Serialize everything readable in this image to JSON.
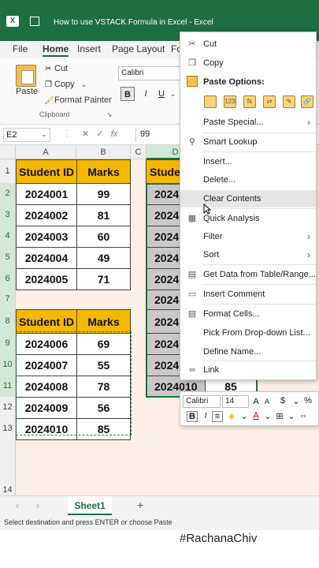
{
  "titlebar": {
    "app_icon": "excel-icon",
    "title": "How to use VSTACK Formula in Excel  -  Excel"
  },
  "ribbon_tabs": [
    "File",
    "Home",
    "Insert",
    "Page Layout",
    "Fo"
  ],
  "ribbon": {
    "paste_label": "Paste",
    "cut_label": "Cut",
    "copy_label": "Copy",
    "format_painter_label": "Format Painter",
    "clipboard_group_label": "Clipboard",
    "font_name": "Calibri",
    "bold": "B",
    "italic": "I",
    "underline": "U"
  },
  "formula_bar": {
    "name_box": "E2",
    "fx_label": "fx",
    "value": "99"
  },
  "columns": [
    "A",
    "B",
    "C",
    "D"
  ],
  "rows": [
    "1",
    "2",
    "3",
    "4",
    "5",
    "6",
    "7",
    "8",
    "9",
    "10",
    "11",
    "12",
    "13",
    "14"
  ],
  "table1": {
    "headers": [
      "Student ID",
      "Marks"
    ],
    "rows": [
      [
        "2024001",
        "99"
      ],
      [
        "2024002",
        "81"
      ],
      [
        "2024003",
        "60"
      ],
      [
        "2024004",
        "49"
      ],
      [
        "2024005",
        "71"
      ]
    ]
  },
  "table2": {
    "headers": [
      "Student ID",
      "Marks"
    ],
    "rows": [
      [
        "2024006",
        "69"
      ],
      [
        "2024007",
        "55"
      ],
      [
        "2024008",
        "78"
      ],
      [
        "2024009",
        "56"
      ],
      [
        "2024010",
        "85"
      ]
    ]
  },
  "result": {
    "header": "Studen",
    "ids": [
      "2024",
      "2024",
      "2024",
      "2024",
      "2024",
      "2024",
      "2024",
      "2024",
      "2024",
      "2024010"
    ],
    "last_mark": "85"
  },
  "context_menu": {
    "cut": "Cut",
    "copy": "Copy",
    "paste_options": "Paste Options:",
    "paste_special": "Paste Special...",
    "smart_lookup": "Smart Lookup",
    "insert": "Insert...",
    "delete": "Delete...",
    "clear_contents": "Clear Contents",
    "quick_analysis": "Quick Analysis",
    "filter": "Filter",
    "sort": "Sort",
    "get_data": "Get Data from Table/Range...",
    "insert_comment": "Insert Comment",
    "format_cells": "Format Cells...",
    "pick_list": "Pick From Drop-down List...",
    "define_name": "Define Name...",
    "link": "Link"
  },
  "mini_toolbar": {
    "font": "Calibri",
    "size": "14",
    "bold": "B",
    "italic": "I"
  },
  "sheet_tab": "Sheet1",
  "status_text": "Select destination and press ENTER or choose Paste",
  "watermark": "#RachanaChiv",
  "colors": {
    "excel_green": "#1e6e42",
    "header_yellow": "#f5b800",
    "sheet_bg": "#fcefe8",
    "grey_cell": "#c9c9c9"
  }
}
